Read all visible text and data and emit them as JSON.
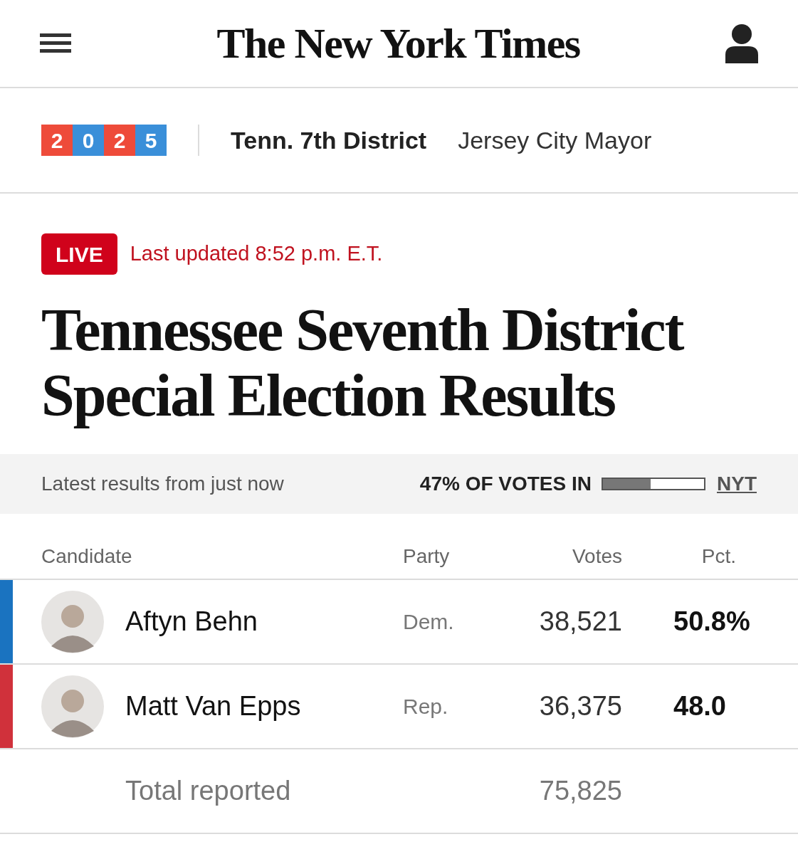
{
  "header": {
    "logo": "The New York Times"
  },
  "nav": {
    "year_digits": [
      {
        "text": "2",
        "color": "#ee4b3a"
      },
      {
        "text": "0",
        "color": "#3a8fd9"
      },
      {
        "text": "2",
        "color": "#ee4b3a"
      },
      {
        "text": "5",
        "color": "#3a8fd9"
      }
    ],
    "links": [
      {
        "label": "Tenn. 7th District",
        "selected": true
      },
      {
        "label": "Jersey City Mayor",
        "selected": false
      }
    ]
  },
  "live": {
    "badge": "LIVE",
    "updated": "Last updated 8:52 p.m. E.T."
  },
  "headline": "Tennessee Seventh District Special Election Results",
  "summary": {
    "latest": "Latest results from just now",
    "votes_in": "47% OF VOTES IN",
    "level": 0.47,
    "source": "NYT"
  },
  "table": {
    "columns": [
      "Candidate",
      "Party",
      "Votes",
      "Pct."
    ],
    "rows": [
      {
        "name": "Aftyn Behn",
        "party": "Dem.",
        "votes": "38,521",
        "pct": "50.8%",
        "color": "#1a73c0"
      },
      {
        "name": "Matt Van Epps",
        "party": "Rep.",
        "votes": "36,375",
        "pct": "48.0",
        "color": "#d0313b"
      }
    ],
    "total": {
      "label": "Total reported",
      "votes": "75,825"
    }
  }
}
